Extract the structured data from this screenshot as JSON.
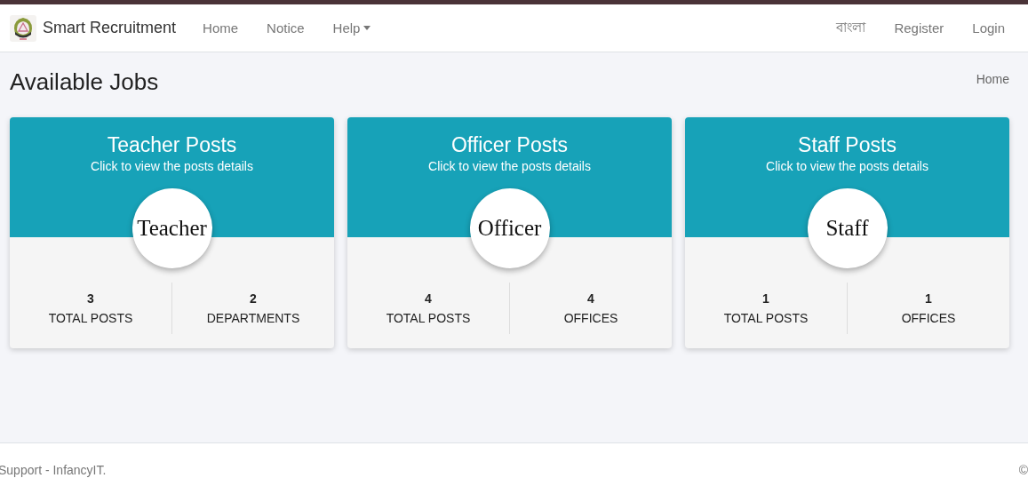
{
  "navbar": {
    "brand": "Smart Recruitment",
    "links": [
      {
        "label": "Home",
        "kind": "link"
      },
      {
        "label": "Notice",
        "kind": "link"
      },
      {
        "label": "Help",
        "kind": "dropdown"
      }
    ],
    "right_links": [
      "বাংলা",
      "Register",
      "Login"
    ]
  },
  "page": {
    "title": "Available Jobs",
    "breadcrumb": "Home"
  },
  "cards": [
    {
      "title": "Teacher Posts",
      "subtitle": "Click to view the posts details",
      "badge": "Teacher",
      "stats": [
        {
          "value": "3",
          "label": "TOTAL POSTS"
        },
        {
          "value": "2",
          "label": "DEPARTMENTS"
        }
      ]
    },
    {
      "title": "Officer Posts",
      "subtitle": "Click to view the posts details",
      "badge": "Officer",
      "stats": [
        {
          "value": "4",
          "label": "TOTAL POSTS"
        },
        {
          "value": "4",
          "label": "OFFICES"
        }
      ]
    },
    {
      "title": "Staff Posts",
      "subtitle": "Click to view the posts details",
      "badge": "Staff",
      "stats": [
        {
          "value": "1",
          "label": "TOTAL POSTS"
        },
        {
          "value": "1",
          "label": "OFFICES"
        }
      ]
    }
  ],
  "footer": {
    "left": "Support - InfancyIT.",
    "right": "©"
  }
}
